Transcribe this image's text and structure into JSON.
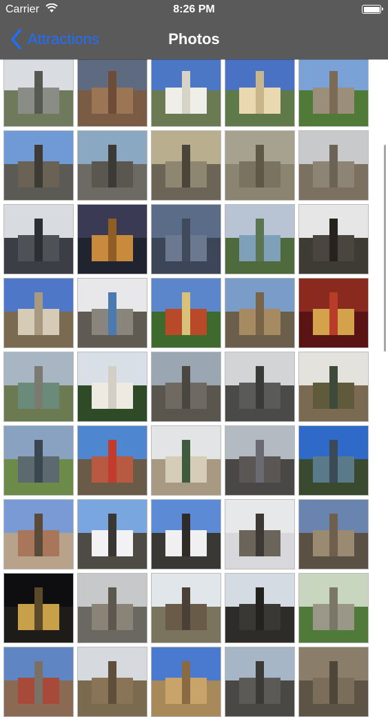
{
  "status_bar": {
    "carrier": "Carrier",
    "time": "8:26 PM"
  },
  "nav": {
    "back_label": "Attractions",
    "title": "Photos"
  },
  "colors": {
    "nav_bg": "#5a5a5a",
    "accent": "#1f6fff"
  },
  "grid": {
    "columns": 5,
    "photos": [
      {
        "sky": "#d9dde2",
        "ground": "#6f7a5c",
        "bld": "#8a8d86",
        "tower": "#55594f"
      },
      {
        "sky": "#5e6a7f",
        "ground": "#7a5b43",
        "bld": "#9c7554",
        "tower": "#6e4c38"
      },
      {
        "sky": "#4b77c4",
        "ground": "#6a7a52",
        "bld": "#f0eee8",
        "tower": "#d7d3c7"
      },
      {
        "sky": "#4a72c4",
        "ground": "#5f7a48",
        "bld": "#e9d8b0",
        "tower": "#c9b68c"
      },
      {
        "sky": "#7aa2d6",
        "ground": "#4f7a38",
        "bld": "#9b8e7a",
        "tower": "#7b6a54"
      },
      {
        "sky": "#6f9ad6",
        "ground": "#5c5a55",
        "bld": "#6b6256",
        "tower": "#3e3a35"
      },
      {
        "sky": "#8aa8c2",
        "ground": "#6c6a62",
        "bld": "#5a5650",
        "tower": "#3c3a36"
      },
      {
        "sky": "#b9ae8d",
        "ground": "#6b6457",
        "bld": "#8f8671",
        "tower": "#4a4538"
      },
      {
        "sky": "#a7a290",
        "ground": "#8b8470",
        "bld": "#7a735f",
        "tower": "#5d5848"
      },
      {
        "sky": "#c8c9cb",
        "ground": "#7c7060",
        "bld": "#8d8475",
        "tower": "#6a6356"
      },
      {
        "sky": "#d8dbe0",
        "ground": "#3b3f45",
        "bld": "#4e5257",
        "tower": "#2c2f33"
      },
      {
        "sky": "#3a3a55",
        "ground": "#1f2430",
        "bld": "#c88a3d",
        "tower": "#8f5e24"
      },
      {
        "sky": "#5a6c88",
        "ground": "#3c4658",
        "bld": "#6c7890",
        "tower": "#404a5c"
      },
      {
        "sky": "#b8c4d4",
        "ground": "#4f6a3c",
        "bld": "#7ea0b8",
        "tower": "#5a7550"
      },
      {
        "sky": "#e6e6e6",
        "ground": "#3e3a34",
        "bld": "#4a453e",
        "tower": "#26231f"
      },
      {
        "sky": "#4f77c8",
        "ground": "#7a6a52",
        "bld": "#d6cbb6",
        "tower": "#a89a80"
      },
      {
        "sky": "#e8e8ea",
        "ground": "#5f5a52",
        "bld": "#8a857c",
        "tower": "#4a7ab0"
      },
      {
        "sky": "#5c86cc",
        "ground": "#3f6a2e",
        "bld": "#b84a2a",
        "tower": "#d8c27a"
      },
      {
        "sky": "#7a9cc8",
        "ground": "#6b5e4a",
        "bld": "#a68a62",
        "tower": "#7a6448"
      },
      {
        "sky": "#8a2a1e",
        "ground": "#5a1414",
        "bld": "#d4a24a",
        "tower": "#b83c2a"
      },
      {
        "sky": "#a7b6c2",
        "ground": "#6c7a52",
        "bld": "#6a8a7a",
        "tower": "#7a7a70"
      },
      {
        "sky": "#d8dfe6",
        "ground": "#2f4a26",
        "bld": "#eeeae2",
        "tower": "#d4cfc4"
      },
      {
        "sky": "#9aa6b2",
        "ground": "#5a564e",
        "bld": "#6e6a62",
        "tower": "#4a4640"
      },
      {
        "sky": "#d2d4d6",
        "ground": "#4a4a48",
        "bld": "#5a5a58",
        "tower": "#3a3a38"
      },
      {
        "sky": "#e4e2dc",
        "ground": "#7a6a52",
        "bld": "#5f5a3c",
        "tower": "#3d4a3a"
      },
      {
        "sky": "#8aa2c2",
        "ground": "#6c8a48",
        "bld": "#5c6a70",
        "tower": "#3a4650"
      },
      {
        "sky": "#4f86d0",
        "ground": "#6a5a48",
        "bld": "#b85a42",
        "tower": "#c23c2e"
      },
      {
        "sky": "#e2e4e6",
        "ground": "#a89a82",
        "bld": "#d6cdb8",
        "tower": "#3f5a3c"
      },
      {
        "sky": "#b4bac2",
        "ground": "#4a4846",
        "bld": "#5a5654",
        "tower": "#6a6a72"
      },
      {
        "sky": "#2f6ac8",
        "ground": "#3a4a2e",
        "bld": "#5a7a8a",
        "tower": "#3a4a56"
      },
      {
        "sky": "#7a9ad6",
        "ground": "#b8a28a",
        "bld": "#a8765a",
        "tower": "#5a4a3a"
      },
      {
        "sky": "#7aa6e0",
        "ground": "#4e4a44",
        "bld": "#f2f2f4",
        "tower": "#3a3632"
      },
      {
        "sky": "#5c8ad4",
        "ground": "#3a3834",
        "bld": "#f0f0f2",
        "tower": "#2e2b28"
      },
      {
        "sky": "#e6e8ea",
        "ground": "#d8d8dc",
        "bld": "#6a645a",
        "tower": "#3c3934"
      },
      {
        "sky": "#6a84b0",
        "ground": "#5a5044",
        "bld": "#9a8a72",
        "tower": "#6e604c"
      },
      {
        "sky": "#0e0e10",
        "ground": "#1e1c18",
        "bld": "#c8a04a",
        "tower": "#5a4a2a"
      },
      {
        "sky": "#c6c8ca",
        "ground": "#6a6860",
        "bld": "#8a8478",
        "tower": "#5c5850"
      },
      {
        "sky": "#e0e6ea",
        "ground": "#7a745e",
        "bld": "#6a5a48",
        "tower": "#4a4036"
      },
      {
        "sky": "#d4dbe2",
        "ground": "#2e2c28",
        "bld": "#3a3834",
        "tower": "#24221e"
      },
      {
        "sky": "#c8d6c0",
        "ground": "#4f7a3a",
        "bld": "#9a9688",
        "tower": "#7a7668"
      },
      {
        "sky": "#5f86c2",
        "ground": "#8a6a52",
        "bld": "#a84a3a",
        "tower": "#7a7066"
      },
      {
        "sky": "#d6dade",
        "ground": "#7a6a4e",
        "bld": "#8a7458",
        "tower": "#5e4e3a"
      },
      {
        "sky": "#4a7ad0",
        "ground": "#a88a5a",
        "bld": "#c8a46a",
        "tower": "#8a6a42"
      },
      {
        "sky": "#a6b6c6",
        "ground": "#4a4844",
        "bld": "#5c5a56",
        "tower": "#3c3a36"
      },
      {
        "sky": "#8a7e6a",
        "ground": "#5e5446",
        "bld": "#7a6e5a",
        "tower": "#4e4638"
      }
    ]
  }
}
